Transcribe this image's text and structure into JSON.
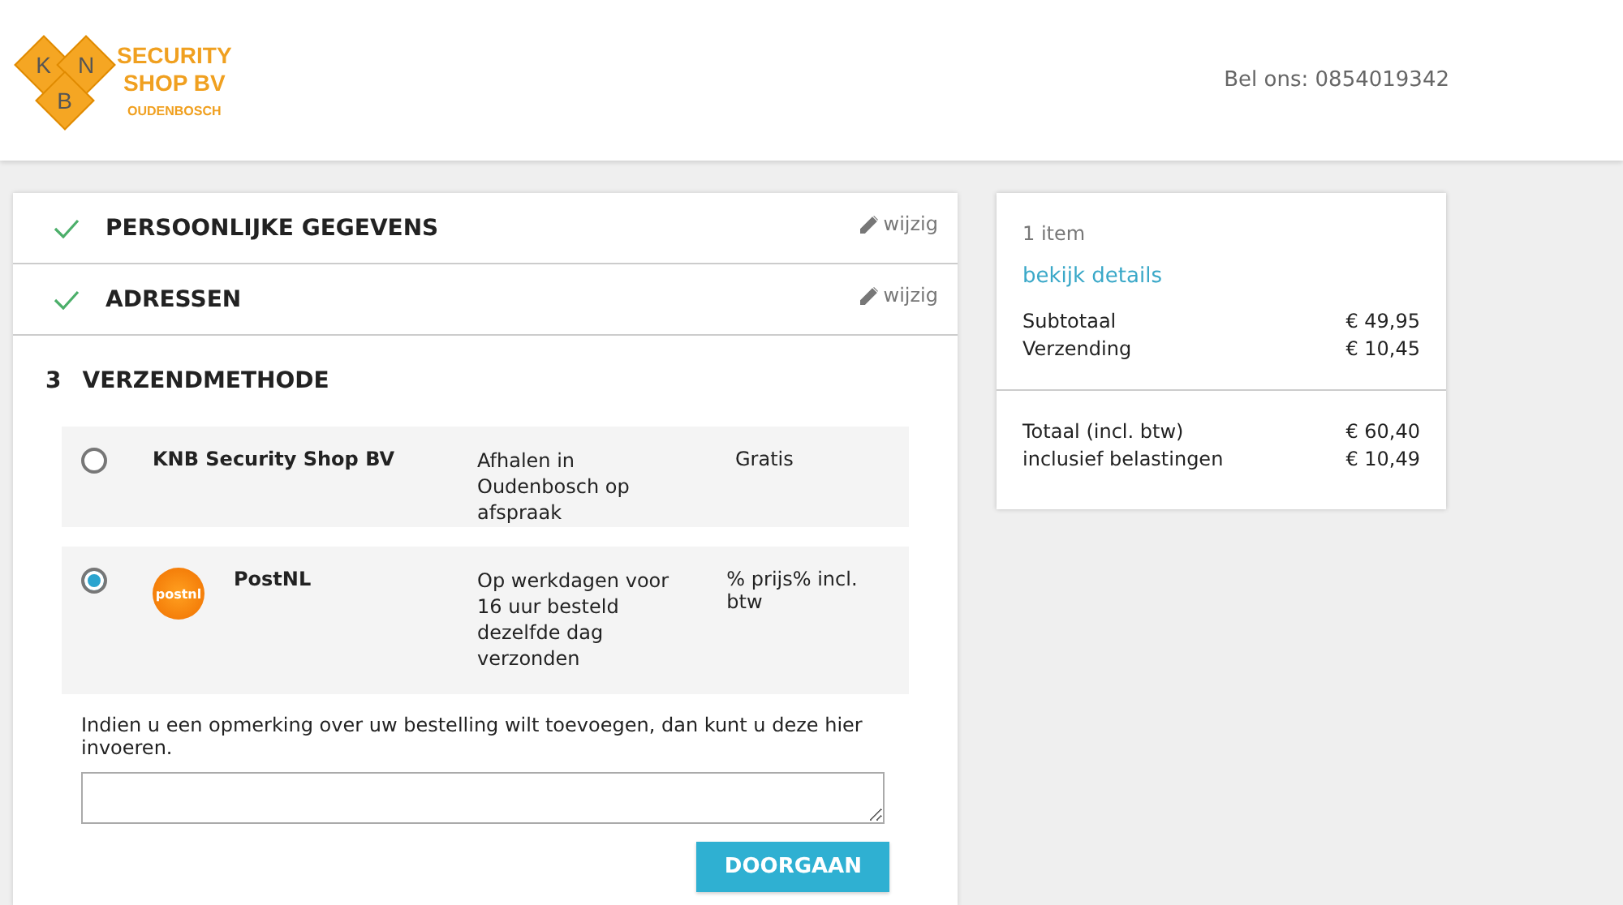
{
  "header": {
    "logo": {
      "letters": [
        "K",
        "N",
        "B"
      ],
      "name_lines": [
        "SECURITY",
        "SHOP BV"
      ],
      "place": "OUDENBOSCH"
    },
    "phone": "Bel ons: 0854019342"
  },
  "steps": [
    {
      "kind": "done",
      "title": "PERSOONLIJKE GEGEVENS",
      "edit": "wijzig"
    },
    {
      "kind": "done",
      "title": "ADRESSEN",
      "edit": "wijzig"
    },
    {
      "kind": "current",
      "number": "3",
      "title": "VERZENDMETHODE"
    }
  ],
  "shipping_options": [
    {
      "name": "KNB Security Shop BV",
      "description": "Afhalen in Oudenbosch op afspraak",
      "price": "Gratis",
      "selected": false
    },
    {
      "name": "PostNL",
      "logo": "postnl",
      "description": "Op werkdagen voor 16 uur besteld dezelfde dag verzonden",
      "price": "% prijs% incl. btw",
      "selected": true
    }
  ],
  "remark": {
    "label": "Indien u een opmerking over uw bestelling wilt toevoegen, dan kunt u deze hier invoeren."
  },
  "continue_button": "DOORGAAN",
  "summary": {
    "count": "1 item",
    "details_link": "bekijk details",
    "lines": [
      {
        "label": "Subtotaal",
        "value": "€ 49,95"
      },
      {
        "label": "Verzending",
        "value": "€ 10,45"
      }
    ],
    "total_lines": [
      {
        "label": "Totaal (incl. btw)",
        "value": "€ 60,40"
      },
      {
        "label": "inclusief belastingen",
        "value": "€ 10,49"
      }
    ]
  }
}
